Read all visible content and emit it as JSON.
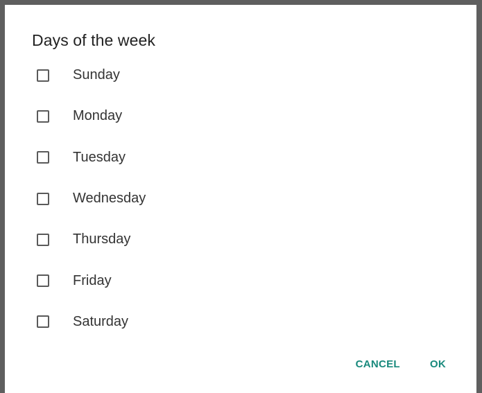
{
  "dialog": {
    "title": "Days of the week",
    "days": [
      {
        "label": "Sunday",
        "checked": false
      },
      {
        "label": "Monday",
        "checked": false
      },
      {
        "label": "Tuesday",
        "checked": false
      },
      {
        "label": "Wednesday",
        "checked": false
      },
      {
        "label": "Thursday",
        "checked": false
      },
      {
        "label": "Friday",
        "checked": false
      },
      {
        "label": "Saturday",
        "checked": false
      }
    ],
    "cancel_label": "CANCEL",
    "ok_label": "OK",
    "accent_color": "#18897c"
  }
}
